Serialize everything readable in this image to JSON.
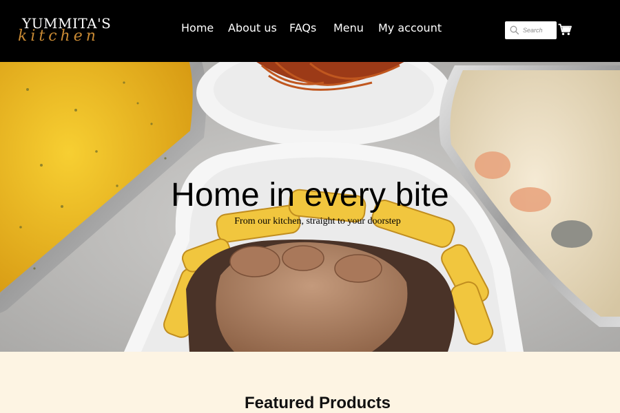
{
  "brand": {
    "logo_top": "YUMMITA'S",
    "logo_script": "kitchen",
    "accent": "#c98a34"
  },
  "nav": {
    "items": [
      {
        "label": "Home"
      },
      {
        "label": "About us"
      },
      {
        "label": "FAQs"
      },
      {
        "label": "Menu"
      },
      {
        "label": "My account"
      }
    ]
  },
  "search": {
    "placeholder": "Search",
    "icon": "search-icon"
  },
  "cart": {
    "icon": "cart-icon"
  },
  "hero": {
    "title": "Home in every bite",
    "subtitle": "From our kitchen, straight to your doorstep"
  },
  "featured": {
    "title": "Featured Products"
  },
  "colors": {
    "header_bg": "#000000",
    "section_bg": "#fdf4e3"
  }
}
